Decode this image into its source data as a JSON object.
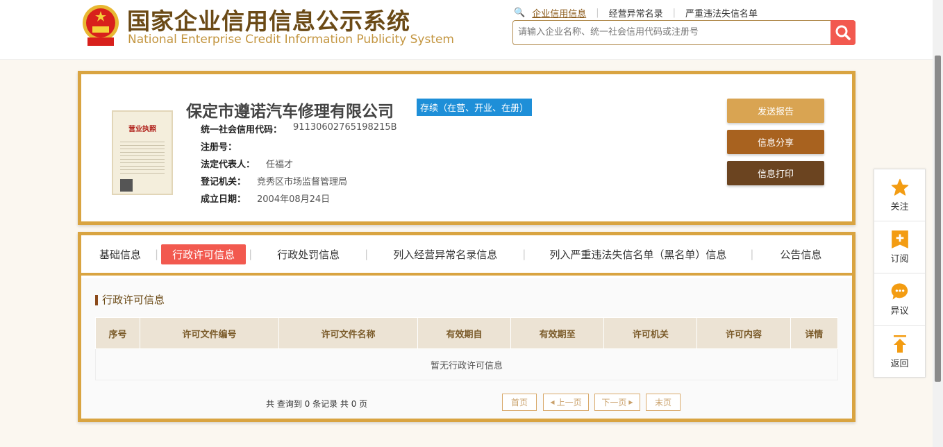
{
  "header": {
    "title_cn": "国家企业信用信息公示系统",
    "title_en": "National Enterprise Credit Information Publicity System",
    "links": [
      "企业信用信息",
      "经营异常名录",
      "严重违法失信名单"
    ],
    "search_placeholder": "请输入企业名称、统一社会信用代码或注册号"
  },
  "company": {
    "name": "保定市遵诺汽车修理有限公司",
    "status": "存续（在营、开业、在册）",
    "fields": [
      {
        "label": "统一社会信用代码：",
        "value": "91130602765198215B"
      },
      {
        "label": "注册号：",
        "value": ""
      },
      {
        "label": "法定代表人：",
        "value": "任福才"
      },
      {
        "label": "登记机关：",
        "value": "竞秀区市场监督管理局"
      },
      {
        "label": "成立日期：",
        "value": "2004年08月24日"
      }
    ],
    "actions": [
      "发送报告",
      "信息分享",
      "信息打印"
    ],
    "license_title": "营业执照"
  },
  "tabs": [
    "基础信息",
    "行政许可信息",
    "行政处罚信息",
    "列入经营异常名录信息",
    "列入严重违法失信名单（黑名单）信息",
    "公告信息"
  ],
  "section": {
    "title": "行政许可信息",
    "columns": [
      "序号",
      "许可文件编号",
      "许可文件名称",
      "有效期自",
      "有效期至",
      "许可机关",
      "许可内容",
      "详情"
    ],
    "empty": "暂无行政许可信息",
    "count": "共 查询到 0 条记录 共 0 页",
    "pager": [
      "首页",
      "上一页",
      "下一页",
      "末页"
    ]
  },
  "side": [
    "关注",
    "订阅",
    "异议",
    "返回"
  ],
  "colors": {
    "gold": "#d9a441",
    "red": "#f2594f",
    "blue": "#1e8fd8",
    "orange": "#f39c12"
  }
}
